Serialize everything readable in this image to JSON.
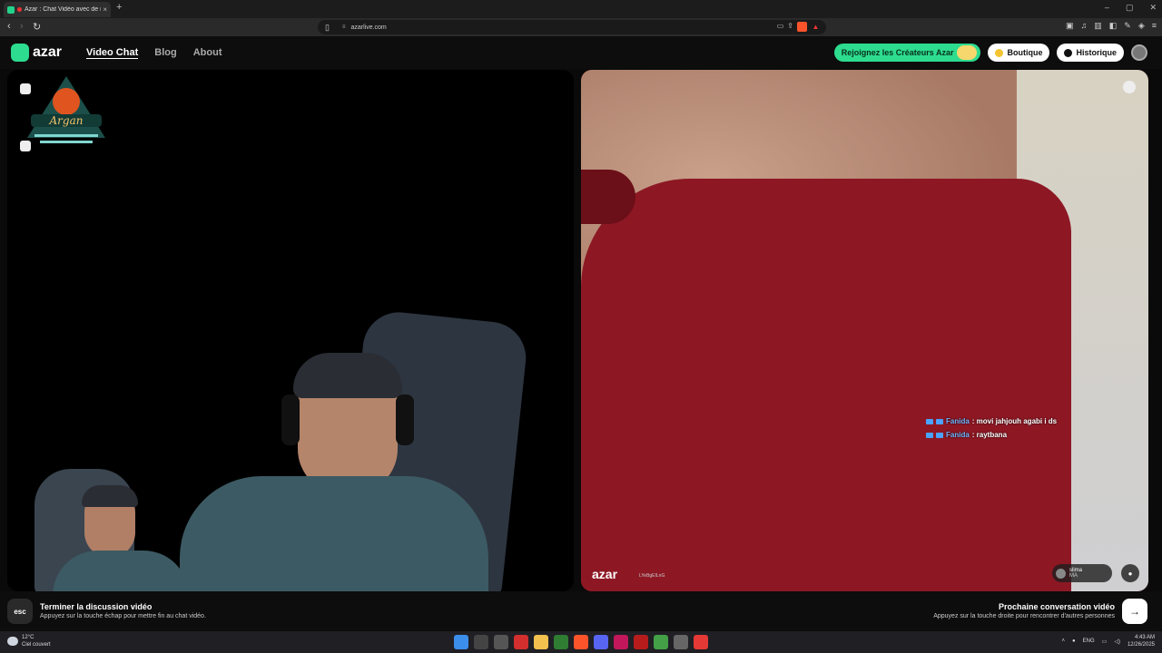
{
  "browser": {
    "tab_title": "Azar : Chat Vidéo avec de no",
    "tab_close": "×",
    "new_tab": "+",
    "url": "azarlive.com",
    "window_controls": [
      "–",
      "▢",
      "✕"
    ]
  },
  "header": {
    "logo_text": "azar",
    "nav": [
      "Video Chat",
      "Blog",
      "About"
    ],
    "creators_button": "Rejoignez les Créateurs Azar",
    "shop_button": "Boutique",
    "history_button": "Historique"
  },
  "remote": {
    "messages": [
      {
        "name": "Fanida",
        "text": ": movi jahjouh agabi i ds"
      },
      {
        "name": "Fanida",
        "text": ": raytbana"
      }
    ],
    "watermark": "azar",
    "watermark_id": "LYeBgEILnG",
    "user_name": "slima",
    "user_country": "MA"
  },
  "local": {
    "logo_text": "Argan"
  },
  "bottom": {
    "esc_label": "esc",
    "end_title": "Terminer la discussion vidéo",
    "end_sub": "Appuyez sur la touche échap pour mettre fin au chat vidéo.",
    "next_title": "Prochaine conversation vidéo",
    "next_sub": "Appuyez sur la touche droite pour rencontrer d'autres personnes",
    "next_arrow": "→"
  },
  "taskbar": {
    "temp": "12°C",
    "weather": "Ciel couvert",
    "lang": "ENG",
    "time": "4:43 AM",
    "date": "12/26/2025"
  },
  "colors": {
    "brand": "#2ddc8f",
    "sweater": "#8d1824"
  }
}
